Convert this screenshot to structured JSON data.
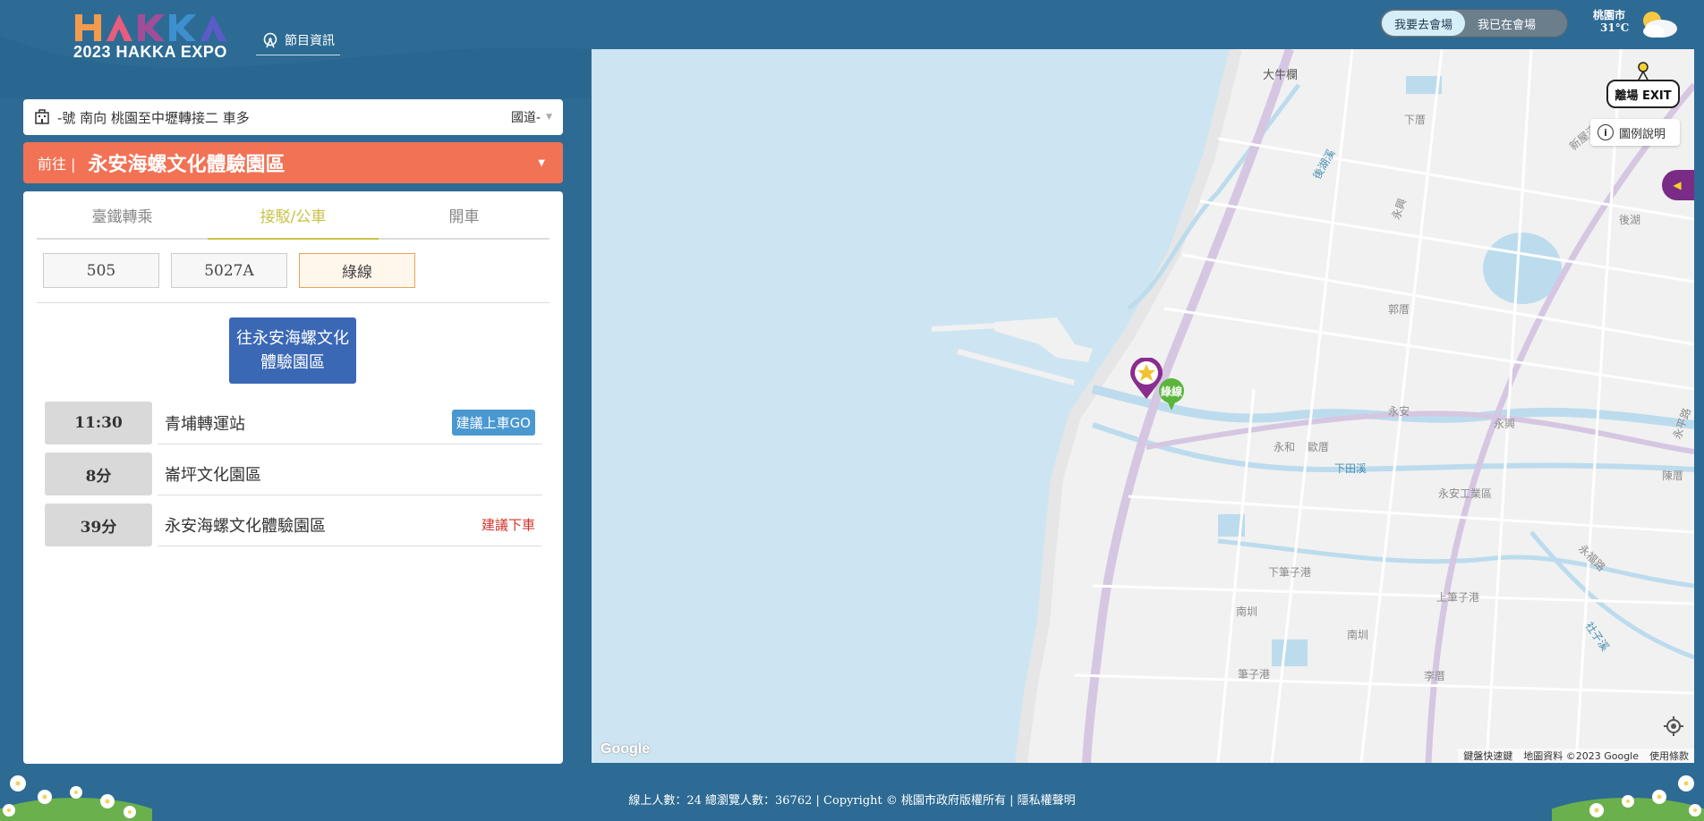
{
  "header": {
    "logo_letters": [
      "H",
      "A",
      "K",
      "K",
      "A"
    ],
    "logo_subtitle": "2023 HAKKA EXPO",
    "program_link": "節目資訊",
    "toggle": {
      "option_go": "我要去會場",
      "option_at": "我已在會場",
      "active": "option_go"
    },
    "weather": {
      "city": "桃園市",
      "temperature": "31°C",
      "icon": "partly-cloudy-icon"
    }
  },
  "route_select": {
    "text": "-號 南向 桃園至中壢轉接二 車多",
    "right_text": "國道-",
    "icon": "building-icon"
  },
  "destination": {
    "prefix": "前往 |",
    "name": "永安海螺文化體驗園區"
  },
  "tabs": [
    {
      "label": "臺鐵轉乘",
      "active": false
    },
    {
      "label": "接駁/公車",
      "active": true
    },
    {
      "label": "開車",
      "active": false
    }
  ],
  "bus_lines": [
    {
      "label": "505",
      "active": false
    },
    {
      "label": "5027A",
      "active": false
    },
    {
      "label": "綠線",
      "active": true
    }
  ],
  "direction_button": "往永安海螺文化體驗園區",
  "stops": [
    {
      "time": "11:30",
      "name": "青埔轉運站",
      "tag": "建議上車GO",
      "tag_type": "go"
    },
    {
      "time": "8分",
      "name": "崙坪文化園區",
      "tag": "",
      "tag_type": ""
    },
    {
      "time": "39分",
      "name": "永安海螺文化體驗園區",
      "tag": "建議下車",
      "tag_type": "off"
    }
  ],
  "map": {
    "exit_label": "離場 EXIT",
    "legend_label": "圖例說明",
    "google_logo": "Google",
    "footer": [
      "鍵盤快速鍵",
      "地圖資料 ©2023 Google",
      "使用條款"
    ],
    "green_marker_label": "綠線",
    "place_labels": {
      "daniu": "大牛欄",
      "xiacuo": "下厝",
      "houhu_creek": "後湖溪",
      "yongxing": "永興",
      "houhu": "後湖",
      "guocuo": "郭厝",
      "yongan": "永安",
      "yongxing2": "永興",
      "yonghe": "永和",
      "yucuo": "歐厝",
      "xiatian": "下田溪",
      "yongan_ind": "永安工業區",
      "xia_bizi": "下筆子港",
      "shang_bizi": "上筆子港",
      "nanpu": "南圳",
      "nanpu2": "南圳",
      "bizi": "筆子港",
      "chencuo": "陳厝",
      "xinwu": "新屋溪",
      "lico": "李厝",
      "shezi": "社子溪",
      "yongfu": "永福路",
      "yongan_rd": "永平路"
    }
  },
  "footer": {
    "text": "線上人數：24 總瀏覽人數：36762 | Copyright © 桃園市政府版權所有 | 隱私權聲明"
  },
  "colors": {
    "background": "#2d6b94",
    "destination_bar": "#f27255",
    "active_tab": "#c8c247",
    "direction_button": "#3b68b5",
    "go_tag": "#4a98d0",
    "off_tag": "#d3332b",
    "water": "#cde5f2",
    "land": "#f2f2f2",
    "highway": "#d3c4e0"
  }
}
